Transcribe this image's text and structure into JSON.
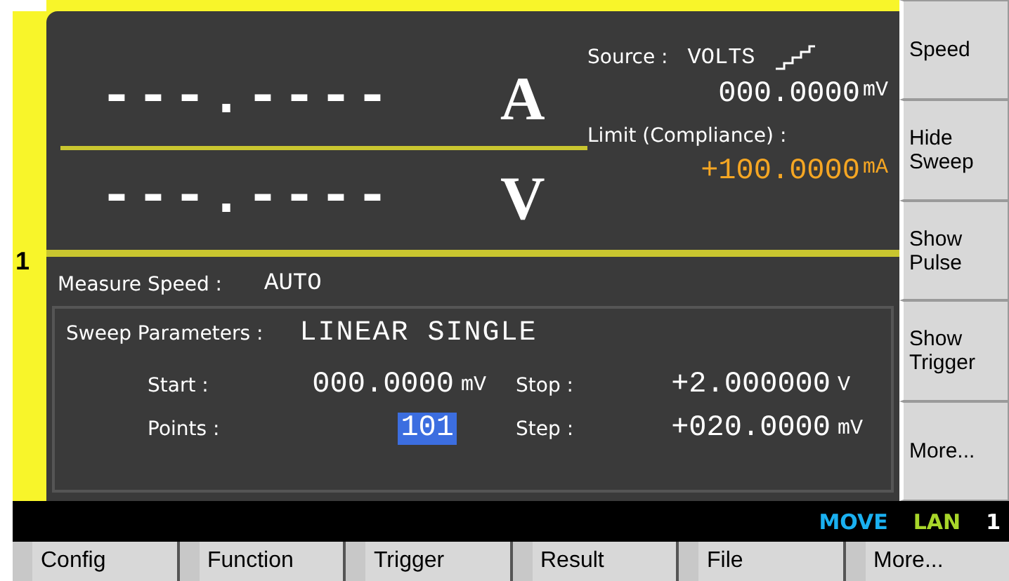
{
  "channel": "1",
  "readings": [
    {
      "value": "---.----",
      "unit": "A"
    },
    {
      "value": "---.----",
      "unit": "V"
    }
  ],
  "source": {
    "label": "Source :",
    "mode": "VOLTS",
    "value": "000.0000",
    "unit": "mV"
  },
  "limit": {
    "label": "Limit (Compliance) :",
    "value": "+100.0000",
    "unit": "mA"
  },
  "measure_speed": {
    "label": "Measure Speed :",
    "value": "AUTO"
  },
  "sweep": {
    "label": "Sweep Parameters :",
    "mode": "LINEAR SINGLE",
    "fields": [
      {
        "label": "Start :",
        "value": "000.0000",
        "unit": "mV",
        "selected": false
      },
      {
        "label": "Stop :",
        "value": "+2.000000",
        "unit": "V",
        "selected": false
      },
      {
        "label": "Points :",
        "value": "101",
        "selected": true
      },
      {
        "label": "Step :",
        "value": "+020.0000",
        "unit": "mV",
        "selected": false
      }
    ]
  },
  "softkeys": [
    "Speed",
    "Hide Sweep",
    "Show Pulse",
    "Show Trigger",
    "More..."
  ],
  "status_bar": {
    "move": "MOVE",
    "lan": "LAN",
    "channel": "1"
  },
  "function_keys": [
    "Config",
    "Function",
    "Trigger",
    "Result",
    "File",
    "More..."
  ]
}
